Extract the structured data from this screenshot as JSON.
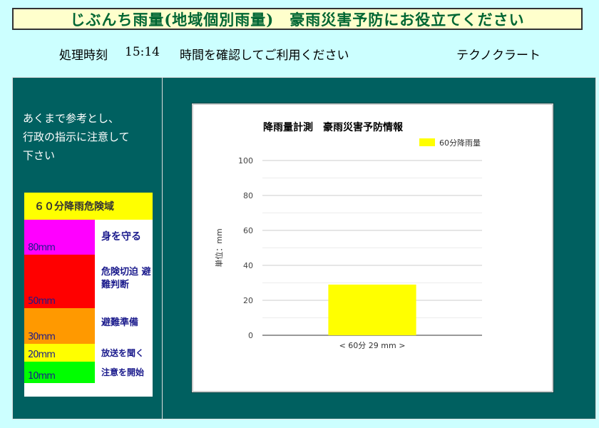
{
  "header": {
    "title": "じぶんち雨量(地域個別雨量)　豪雨災害予防にお役立てください"
  },
  "info": {
    "time_label": "処理時刻",
    "time_value": "15:14",
    "message": "時間を確認してご利用ください",
    "brand": "テクノクラート"
  },
  "notice": {
    "lines": [
      "あくまで参考とし、",
      "行政の指示に注意して",
      "下さい"
    ]
  },
  "legend": {
    "title": "６０分降雨危険域",
    "levels": [
      {
        "mm": "80mm",
        "desc": "身を守る",
        "color": "#ff00ff"
      },
      {
        "mm": "50mm",
        "desc": "危険切迫 避難判断",
        "color": "#ff0000"
      },
      {
        "mm": "30mm",
        "desc": "避難準備",
        "color": "#ff9900"
      },
      {
        "mm": "20mm",
        "desc": "放送を聞く",
        "color": "#ffff00"
      },
      {
        "mm": "10mm",
        "desc": "注意を開始",
        "color": "#00ff00"
      }
    ]
  },
  "chart_data": {
    "type": "bar",
    "title": "降雨量計測　豪雨災害予防情報",
    "ylabel": "単位：mm",
    "xlabel": "",
    "categories": [
      "< 60分 29 mm >"
    ],
    "series": [
      {
        "name": "60分降雨量",
        "values": [
          29
        ],
        "color": "#ffff00"
      }
    ],
    "ylim": [
      0,
      100
    ],
    "yticks": [
      0,
      20,
      40,
      60,
      80,
      100
    ],
    "grid": true,
    "legend_position": "top-right"
  }
}
